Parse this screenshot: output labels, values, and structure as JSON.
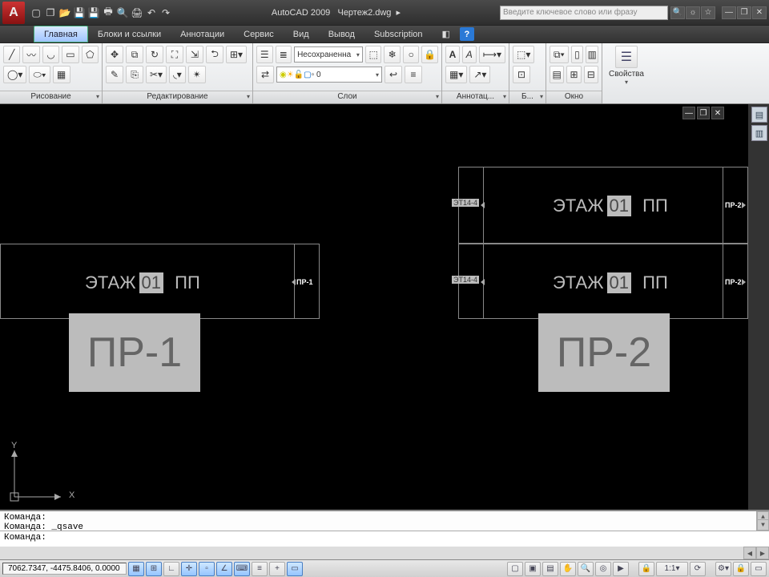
{
  "title": {
    "app": "AutoCAD 2009",
    "doc": "Чертеж2.dwg",
    "search_placeholder": "Введите ключевое слово или фразу"
  },
  "menu": {
    "items": [
      "Главная",
      "Блоки и ссылки",
      "Аннотации",
      "Сервис",
      "Вид",
      "Вывод",
      "Subscription"
    ],
    "active_index": 0,
    "help": "?"
  },
  "ribbon": {
    "panels": [
      {
        "title": "Рисование"
      },
      {
        "title": "Редактирование"
      },
      {
        "title": "Слои",
        "layer_state": "Несохраненна",
        "current_layer": "0"
      },
      {
        "title": "Аннотац..."
      },
      {
        "title": "Б..."
      },
      {
        "title": "Окно"
      },
      {
        "title": "Свойства"
      }
    ]
  },
  "command": {
    "history": [
      "Команда:",
      "Команда: _qsave"
    ],
    "prompt": "Команда:"
  },
  "status": {
    "coords": "7062.7347, -4475.8406, 0.0000",
    "scale": "1:1"
  },
  "drawing": {
    "floor_text_prefix": "ЭТАЖ",
    "floor_num": "01",
    "floor_suffix": "ПП",
    "block1": "ПР-1",
    "block2": "ПР-2",
    "mini_pr1": "ПР-1",
    "mini_pr2": "ПР-2",
    "tag": "ЭТ14-4",
    "axis_x": "X",
    "axis_y": "Y"
  }
}
